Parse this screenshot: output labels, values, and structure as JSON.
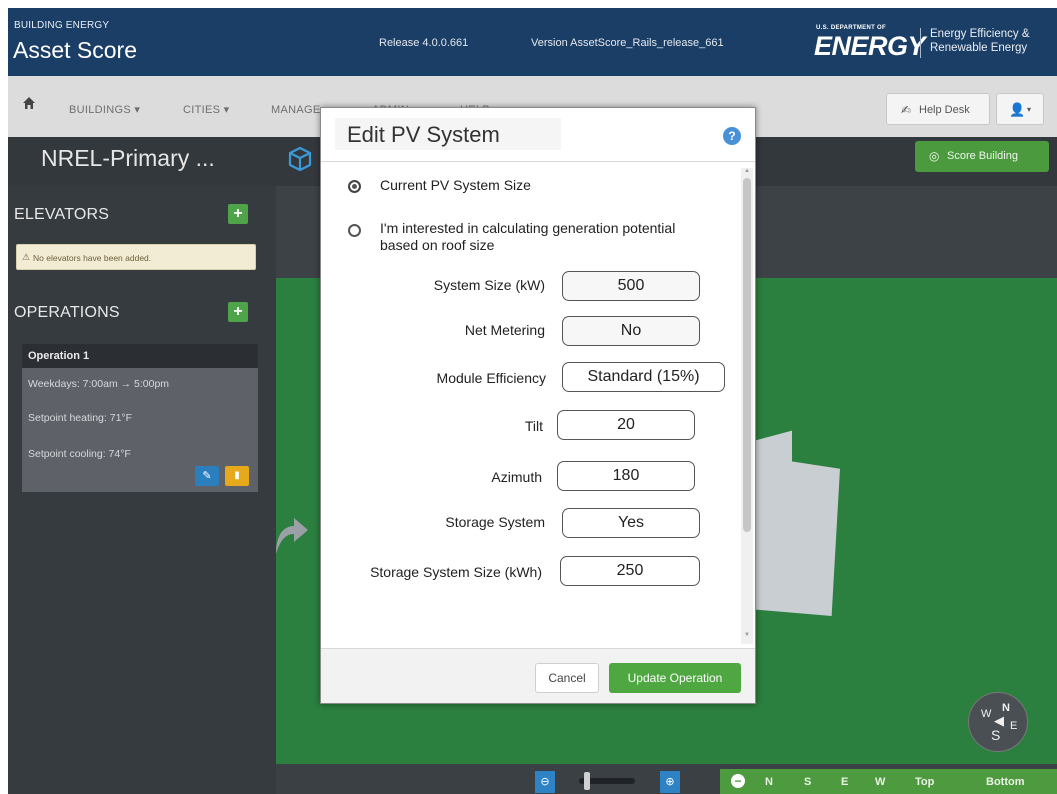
{
  "header": {
    "brand_sub": "BUILDING ENERGY",
    "brand_title": "Asset Score",
    "release": "Release 4.0.0.661",
    "version": "Version AssetScore_Rails_release_661",
    "doe_small": "U.S. DEPARTMENT OF",
    "doe_big": "ENERGY",
    "eere_line1": "Energy Efficiency &",
    "eere_line2": "Renewable Energy"
  },
  "nav": {
    "items": [
      "BUILDINGS ▾",
      "CITIES ▾",
      "MANAGE ▾",
      "ADMIN ▾",
      "HELP ▾"
    ],
    "help_desk": "Help Desk",
    "user_caret": "▾"
  },
  "building": {
    "name": "NREL-Primary ...",
    "score_button": "Score Building"
  },
  "sidebar": {
    "elevators_title": "ELEVATORS",
    "elevators_warning": "No elevators have been added.",
    "operations_title": "OPERATIONS",
    "operation": {
      "name": "Operation 1",
      "schedule": "Weekdays: 7:00am → 5:00pm",
      "heating": "Setpoint heating: 71°F",
      "cooling": "Setpoint cooling: 74°F"
    }
  },
  "modal": {
    "title": "Edit PV System",
    "option_current": "Current PV System Size",
    "option_roof": "I'm interested in calculating generation potential based on roof size",
    "selected_option": "current",
    "fields": {
      "system_size_label": "System Size (kW)",
      "system_size_value": "500",
      "net_metering_label": "Net Metering",
      "net_metering_value": "No",
      "module_efficiency_label": "Module Efficiency",
      "module_efficiency_value": "Standard (15%)",
      "tilt_label": "Tilt",
      "tilt_value": "20",
      "azimuth_label": "Azimuth",
      "azimuth_value": "180",
      "storage_system_label": "Storage System",
      "storage_system_value": "Yes",
      "storage_size_label": "Storage System Size (kWh)",
      "storage_size_value": "250"
    },
    "cancel": "Cancel",
    "update": "Update Operation"
  },
  "view_controls": {
    "buttons": [
      "N",
      "S",
      "E",
      "W",
      "Top",
      "Bottom"
    ]
  },
  "compass": {
    "n": "N",
    "w": "W",
    "s": "S",
    "e": "E"
  },
  "colors": {
    "header_bg": "#1b3e66",
    "accent_green": "#4ea740",
    "accent_blue": "#2f83c5",
    "ground_green": "#2b7f3f"
  }
}
